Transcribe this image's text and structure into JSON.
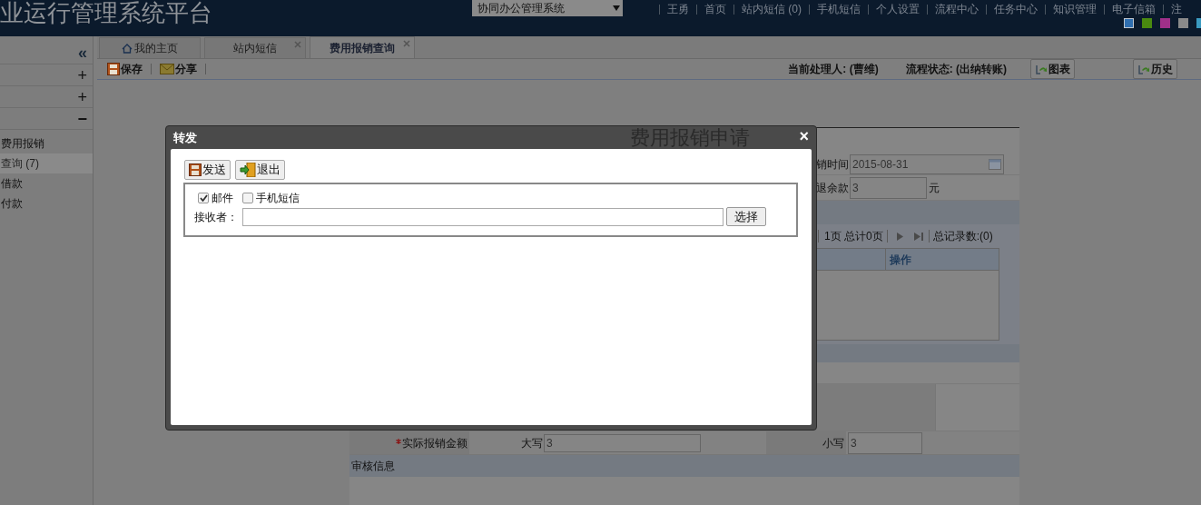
{
  "header": {
    "title": "业运行管理系统平台",
    "system_select": "协同办公管理系统",
    "nav": [
      "王勇",
      "首页",
      "站内短信 (0)",
      "手机短信",
      "个人设置",
      "流程中心",
      "任务中心",
      "知识管理",
      "电子信箱",
      "注"
    ],
    "themes": [
      {
        "color": "#2f6fb0",
        "selected": true
      },
      {
        "color": "#4a8a10",
        "selected": false
      },
      {
        "color": "#a0308a",
        "selected": false
      },
      {
        "color": "#8a8a8a",
        "selected": false
      },
      {
        "color": "#3a9ac0",
        "selected": false
      }
    ]
  },
  "sidebar": {
    "collapse": "«",
    "groups": [
      {
        "toggle": "+",
        "expanded": false
      },
      {
        "toggle": "+",
        "expanded": false
      },
      {
        "toggle": "−",
        "expanded": true
      }
    ],
    "items": [
      {
        "label": "费用报销",
        "selected": false
      },
      {
        "label": "查询 (7)",
        "selected": true
      },
      {
        "label": "借款",
        "selected": false
      },
      {
        "label": "付款",
        "selected": false
      }
    ]
  },
  "tabs": [
    {
      "label": "我的主页",
      "kind": "home",
      "selected": false
    },
    {
      "label": "站内短信",
      "kind": "closable",
      "selected": false
    },
    {
      "label": "费用报销查询",
      "kind": "closable",
      "selected": true
    }
  ],
  "toolbar": {
    "actions": [
      {
        "label": "保存",
        "kind": "save"
      },
      {
        "label": "分享",
        "kind": "mail"
      }
    ],
    "handler": "当前处理人: (曹维)",
    "status": "流程状态: (出纳转账)",
    "buttons": [
      "图表",
      "历史"
    ]
  },
  "form": {
    "title": "费用报销申请",
    "date_label": "销时间",
    "date_value": "2015-08-31",
    "refund_label": "退余款",
    "refund_value": "3",
    "refund_unit": "元",
    "pager": {
      "page": "1页 总计0页",
      "total": "总记录数:(0)"
    },
    "table_column": "操作",
    "amount": {
      "label": "实际报销金额",
      "required": true,
      "upper_label": "大写",
      "upper_value": "3",
      "lower_label": "小写",
      "lower_value": "3"
    },
    "section": "审核信息"
  },
  "dialog": {
    "title": "转发",
    "close": "×",
    "buttons": [
      {
        "label": "发送",
        "kind": "save"
      },
      {
        "label": "退出",
        "kind": "exit"
      }
    ],
    "channels": [
      {
        "label": "邮件",
        "checked": true
      },
      {
        "label": "手机短信",
        "checked": false
      }
    ],
    "recipient_label": "接收者：",
    "choose": "选择"
  }
}
